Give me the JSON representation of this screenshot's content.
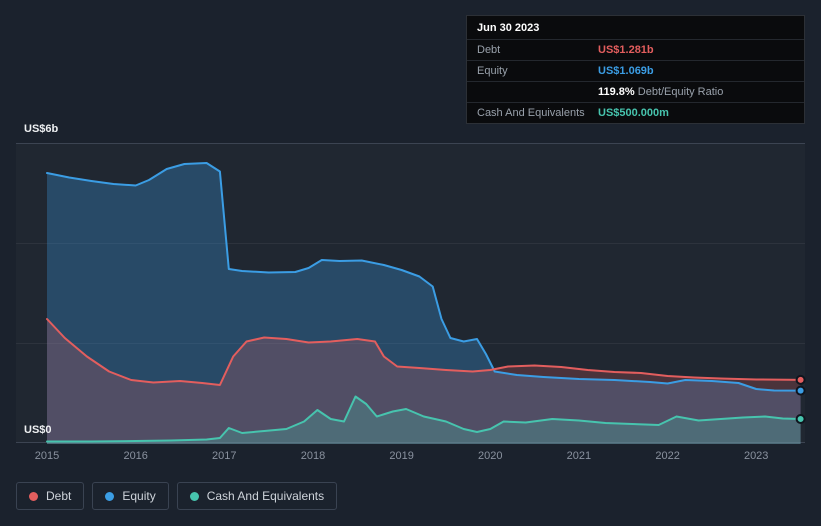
{
  "tooltip": {
    "date": "Jun 30 2023",
    "debt": {
      "label": "Debt",
      "value": "US$1.281b",
      "color": "#e35e5e"
    },
    "equity": {
      "label": "Equity",
      "value": "US$1.069b",
      "color": "#3b9de4"
    },
    "ratio": {
      "value": "119.8%",
      "label": "Debt/Equity Ratio"
    },
    "cash": {
      "label": "Cash And Equivalents",
      "value": "US$500.000m",
      "color": "#47c4ae"
    }
  },
  "legend": {
    "items": [
      {
        "label": "Debt",
        "color": "#e35e5e"
      },
      {
        "label": "Equity",
        "color": "#3b9de4"
      },
      {
        "label": "Cash And Equivalents",
        "color": "#47c4ae"
      }
    ]
  },
  "chart_data": {
    "type": "area",
    "xlim": [
      2014.65,
      2023.55
    ],
    "ylim": [
      0,
      6
    ],
    "grid": "horizontal",
    "legend_position": "bottom-left",
    "y_axis_labels": {
      "max": "US$6b",
      "min": "US$0"
    },
    "x_ticks": [
      {
        "label": "2015",
        "year": 2015
      },
      {
        "label": "2016",
        "year": 2016
      },
      {
        "label": "2017",
        "year": 2017
      },
      {
        "label": "2018",
        "year": 2018
      },
      {
        "label": "2019",
        "year": 2019
      },
      {
        "label": "2020",
        "year": 2020
      },
      {
        "label": "2021",
        "year": 2021
      },
      {
        "label": "2022",
        "year": 2022
      },
      {
        "label": "2023",
        "year": 2023
      }
    ],
    "series": [
      {
        "name": "Equity",
        "color": "#3b9de4",
        "fill_opacity": 0.3,
        "points": [
          [
            2015.0,
            5.42
          ],
          [
            2015.25,
            5.33
          ],
          [
            2015.5,
            5.26
          ],
          [
            2015.75,
            5.2
          ],
          [
            2016.0,
            5.17
          ],
          [
            2016.15,
            5.28
          ],
          [
            2016.35,
            5.5
          ],
          [
            2016.55,
            5.6
          ],
          [
            2016.8,
            5.62
          ],
          [
            2016.95,
            5.45
          ],
          [
            2017.05,
            3.5
          ],
          [
            2017.2,
            3.46
          ],
          [
            2017.5,
            3.43
          ],
          [
            2017.8,
            3.44
          ],
          [
            2017.95,
            3.52
          ],
          [
            2018.1,
            3.68
          ],
          [
            2018.3,
            3.66
          ],
          [
            2018.55,
            3.67
          ],
          [
            2018.8,
            3.58
          ],
          [
            2019.0,
            3.48
          ],
          [
            2019.2,
            3.35
          ],
          [
            2019.35,
            3.15
          ],
          [
            2019.45,
            2.5
          ],
          [
            2019.55,
            2.12
          ],
          [
            2019.7,
            2.05
          ],
          [
            2019.85,
            2.1
          ],
          [
            2019.95,
            1.8
          ],
          [
            2020.05,
            1.45
          ],
          [
            2020.3,
            1.38
          ],
          [
            2020.6,
            1.34
          ],
          [
            2021.0,
            1.3
          ],
          [
            2021.4,
            1.28
          ],
          [
            2021.8,
            1.24
          ],
          [
            2022.0,
            1.21
          ],
          [
            2022.2,
            1.28
          ],
          [
            2022.5,
            1.26
          ],
          [
            2022.8,
            1.22
          ],
          [
            2023.0,
            1.1
          ],
          [
            2023.2,
            1.07
          ],
          [
            2023.5,
            1.069
          ]
        ]
      },
      {
        "name": "Debt",
        "color": "#e35e5e",
        "fill_opacity": 0.22,
        "points": [
          [
            2015.0,
            2.5
          ],
          [
            2015.2,
            2.12
          ],
          [
            2015.45,
            1.75
          ],
          [
            2015.7,
            1.45
          ],
          [
            2015.95,
            1.28
          ],
          [
            2016.2,
            1.23
          ],
          [
            2016.5,
            1.26
          ],
          [
            2016.75,
            1.22
          ],
          [
            2016.95,
            1.18
          ],
          [
            2017.1,
            1.75
          ],
          [
            2017.25,
            2.05
          ],
          [
            2017.45,
            2.13
          ],
          [
            2017.7,
            2.1
          ],
          [
            2017.95,
            2.03
          ],
          [
            2018.2,
            2.05
          ],
          [
            2018.5,
            2.1
          ],
          [
            2018.7,
            2.05
          ],
          [
            2018.8,
            1.75
          ],
          [
            2018.95,
            1.55
          ],
          [
            2019.2,
            1.52
          ],
          [
            2019.5,
            1.48
          ],
          [
            2019.8,
            1.45
          ],
          [
            2020.0,
            1.48
          ],
          [
            2020.2,
            1.55
          ],
          [
            2020.5,
            1.57
          ],
          [
            2020.8,
            1.54
          ],
          [
            2021.1,
            1.48
          ],
          [
            2021.4,
            1.44
          ],
          [
            2021.7,
            1.42
          ],
          [
            2022.0,
            1.36
          ],
          [
            2022.3,
            1.33
          ],
          [
            2022.6,
            1.31
          ],
          [
            2023.0,
            1.29
          ],
          [
            2023.5,
            1.281
          ]
        ]
      },
      {
        "name": "Cash And Equivalents",
        "color": "#47c4ae",
        "fill_opacity": 0.25,
        "points": [
          [
            2015.0,
            0.05
          ],
          [
            2015.5,
            0.05
          ],
          [
            2016.0,
            0.06
          ],
          [
            2016.4,
            0.07
          ],
          [
            2016.8,
            0.09
          ],
          [
            2016.95,
            0.12
          ],
          [
            2017.05,
            0.32
          ],
          [
            2017.2,
            0.22
          ],
          [
            2017.45,
            0.26
          ],
          [
            2017.7,
            0.3
          ],
          [
            2017.9,
            0.45
          ],
          [
            2018.05,
            0.68
          ],
          [
            2018.2,
            0.5
          ],
          [
            2018.35,
            0.45
          ],
          [
            2018.48,
            0.95
          ],
          [
            2018.6,
            0.8
          ],
          [
            2018.72,
            0.55
          ],
          [
            2018.9,
            0.65
          ],
          [
            2019.05,
            0.7
          ],
          [
            2019.25,
            0.55
          ],
          [
            2019.5,
            0.45
          ],
          [
            2019.7,
            0.3
          ],
          [
            2019.85,
            0.24
          ],
          [
            2020.0,
            0.3
          ],
          [
            2020.15,
            0.45
          ],
          [
            2020.4,
            0.43
          ],
          [
            2020.7,
            0.5
          ],
          [
            2021.0,
            0.47
          ],
          [
            2021.3,
            0.42
          ],
          [
            2021.6,
            0.4
          ],
          [
            2021.9,
            0.38
          ],
          [
            2022.1,
            0.55
          ],
          [
            2022.35,
            0.47
          ],
          [
            2022.6,
            0.5
          ],
          [
            2022.85,
            0.53
          ],
          [
            2023.1,
            0.55
          ],
          [
            2023.3,
            0.51
          ],
          [
            2023.5,
            0.5
          ]
        ]
      }
    ]
  }
}
